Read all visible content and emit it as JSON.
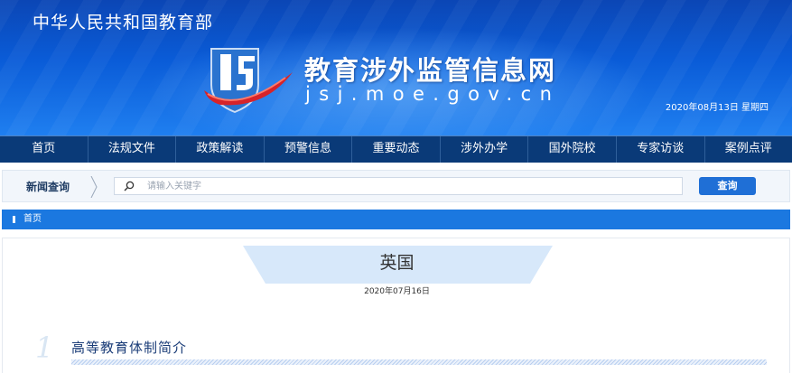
{
  "header": {
    "ministry_name": "中华人民共和国教育部",
    "site_name": "教育涉外监管信息网",
    "site_domain": "jsj.moe.gov.cn",
    "date_display": "2020年08月13日  星期四",
    "logo_icon": "jsj-shield-logo-icon"
  },
  "nav": {
    "items": [
      {
        "label": "首页"
      },
      {
        "label": "法规文件"
      },
      {
        "label": "政策解读"
      },
      {
        "label": "预警信息"
      },
      {
        "label": "重要动态"
      },
      {
        "label": "涉外办学"
      },
      {
        "label": "国外院校"
      },
      {
        "label": "专家访谈"
      },
      {
        "label": "案例点评"
      }
    ]
  },
  "search": {
    "label": "新闻查询",
    "placeholder": "请输入关键字",
    "value": "",
    "button_label": "查询",
    "icon": "search-icon"
  },
  "breadcrumb": {
    "home_label": "首页"
  },
  "article": {
    "title": "英国",
    "date": "2020年07月16日",
    "section_number": "1",
    "section_heading": "高等教育体制简介"
  },
  "colors": {
    "banner": "#0a5cd8",
    "nav_bg": "#0a3a78",
    "accent": "#1b78e0",
    "button": "#1f6fd6",
    "title_tab": "#d7e8fa"
  }
}
